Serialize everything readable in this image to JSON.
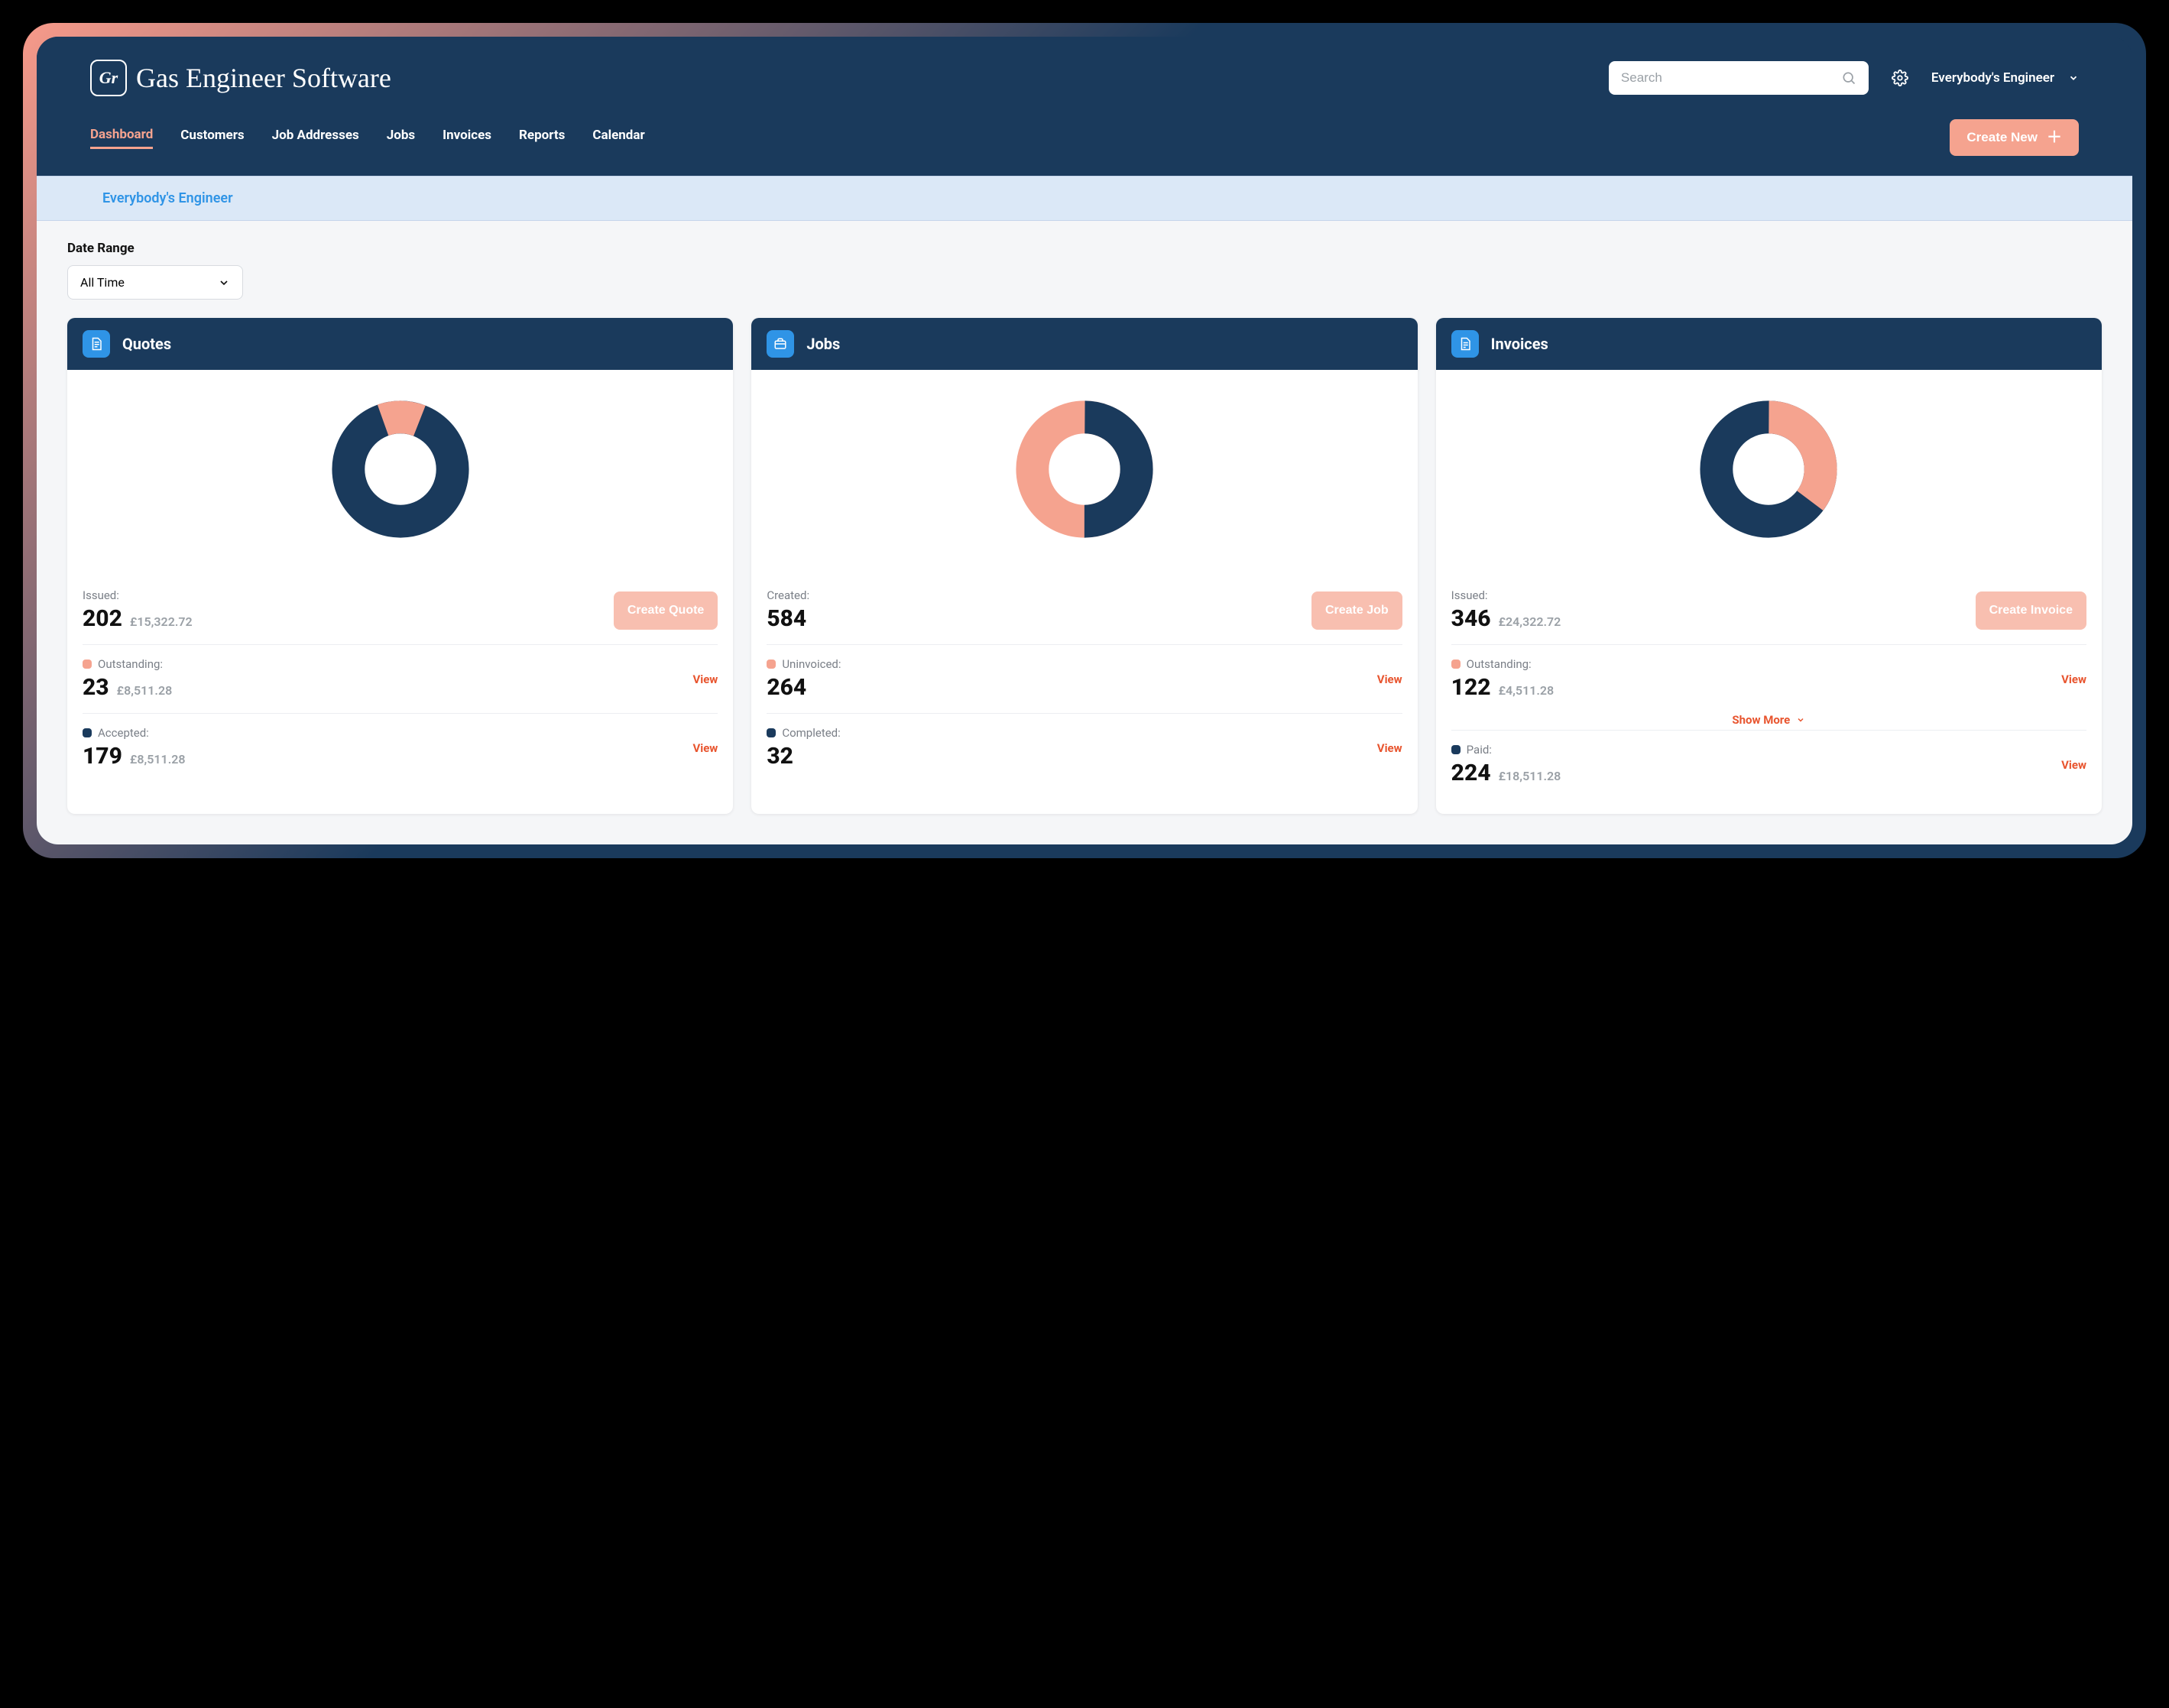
{
  "brand": {
    "mark": "Gr",
    "name": "Gas Engineer Software"
  },
  "search": {
    "placeholder": "Search"
  },
  "user": {
    "name": "Everybody's Engineer"
  },
  "nav": {
    "items": [
      "Dashboard",
      "Customers",
      "Job Addresses",
      "Jobs",
      "Invoices",
      "Reports",
      "Calendar"
    ],
    "active": "Dashboard",
    "create_label": "Create New"
  },
  "breadcrumb": "Everybody's Engineer",
  "date_range": {
    "label": "Date Range",
    "value": "All Time"
  },
  "colors": {
    "navy": "#1a3a5c",
    "peach": "#f5a38f",
    "accent": "#e8552f",
    "blue": "#2f94e6"
  },
  "chart_data": [
    {
      "type": "pie",
      "title": "Quotes",
      "series": [
        {
          "name": "Outstanding",
          "value": 23,
          "color": "#f5a38f"
        },
        {
          "name": "Accepted",
          "value": 179,
          "color": "#1a3a5c"
        }
      ]
    },
    {
      "type": "pie",
      "title": "Jobs",
      "series": [
        {
          "name": "Uninvoiced",
          "value": 264,
          "color": "#f5a38f"
        },
        {
          "name": "Completed",
          "value": 32,
          "color": "#1a3a5c"
        }
      ]
    },
    {
      "type": "pie",
      "title": "Invoices",
      "series": [
        {
          "name": "Outstanding",
          "value": 122,
          "color": "#f5a38f"
        },
        {
          "name": "Paid",
          "value": 224,
          "color": "#1a3a5c"
        }
      ]
    }
  ],
  "cards": {
    "quotes": {
      "title": "Quotes",
      "create_label": "Create Quote",
      "top": {
        "label": "Issued:",
        "num": "202",
        "money": "£15,322.72"
      },
      "mid": {
        "label": "Outstanding:",
        "num": "23",
        "money": "£8,511.28",
        "link": "View"
      },
      "bot": {
        "label": "Accepted:",
        "num": "179",
        "money": "£8,511.28",
        "link": "View"
      }
    },
    "jobs": {
      "title": "Jobs",
      "create_label": "Create Job",
      "top": {
        "label": "Created:",
        "num": "584"
      },
      "mid": {
        "label": "Uninvoiced:",
        "num": "264",
        "link": "View"
      },
      "bot": {
        "label": "Completed:",
        "num": "32",
        "link": "View"
      }
    },
    "invoices": {
      "title": "Invoices",
      "create_label": "Create Invoice",
      "top": {
        "label": "Issued:",
        "num": "346",
        "money": "£24,322.72"
      },
      "mid": {
        "label": "Outstanding:",
        "num": "122",
        "money": "£4,511.28",
        "link": "View"
      },
      "show_more": "Show More",
      "bot": {
        "label": "Paid:",
        "num": "224",
        "money": "£18,511.28",
        "link": "View"
      }
    }
  }
}
